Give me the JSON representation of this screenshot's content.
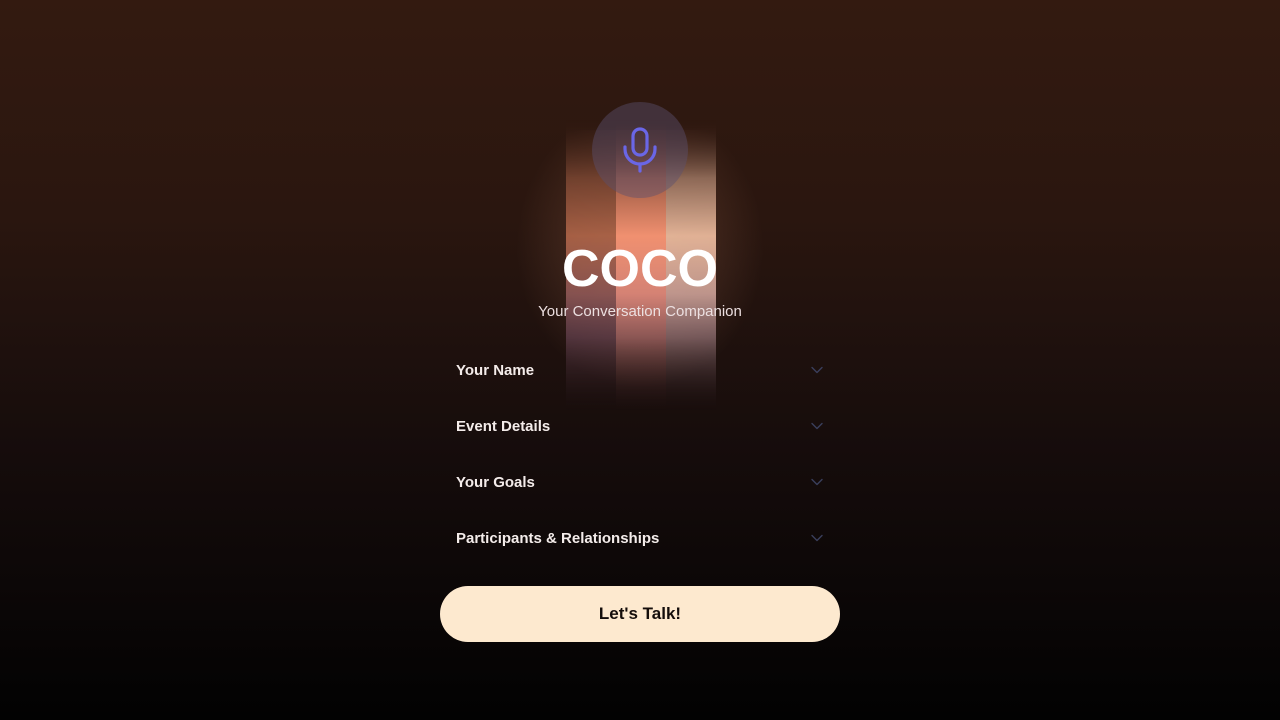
{
  "app": {
    "title": "COCO",
    "subtitle": "Your Conversation Companion"
  },
  "icons": {
    "mic": "microphone-icon",
    "chevron": "chevron-down-icon"
  },
  "form": {
    "sections": [
      {
        "label": "Your Name"
      },
      {
        "label": "Event Details"
      },
      {
        "label": "Your Goals"
      },
      {
        "label": "Participants & Relationships"
      }
    ]
  },
  "cta": {
    "label": "Let's Talk!"
  },
  "colors": {
    "accent_mic": "#6a66e6",
    "button_bg": "#fde9cf",
    "button_text": "#140d0b",
    "chevron": "#3a3f5c"
  }
}
